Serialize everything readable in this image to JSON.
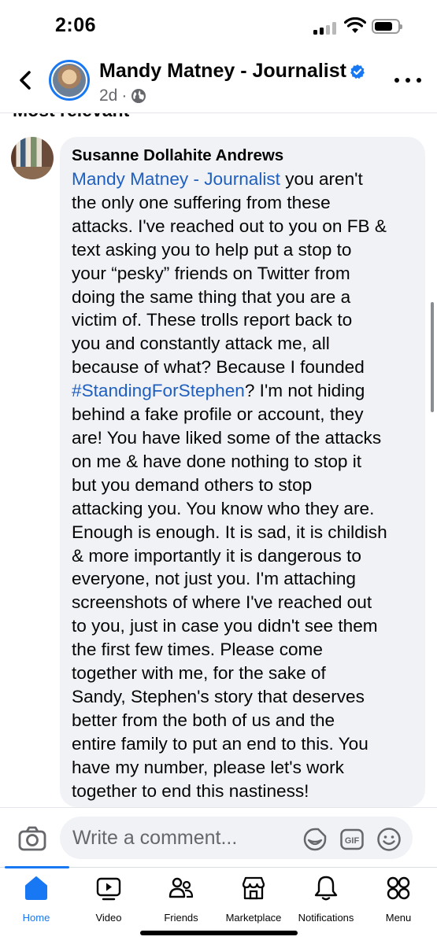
{
  "status_bar": {
    "time": "2:06"
  },
  "header": {
    "page_name": "Mandy Matney - Journalist",
    "verified": true,
    "post_age": "2d",
    "separator": "·",
    "privacy_icon": "globe-icon"
  },
  "comments_section": {
    "heading": "Most relevant",
    "comment": {
      "author": "Susanne Dollahite Andrews",
      "mention": "Mandy Matney - Journalist",
      "text_before_hashtag": " you aren't\nthe only one suffering from these\nattacks. I've reached out to you on FB &\ntext asking you to help put a stop to\nyour “pesky” friends on Twitter from\ndoing the same thing that you are a\nvictim of. These trolls report back to\nyou and constantly attack me, all\nbecause of what? Because I founded\n",
      "hashtag": "#StandingForStephen",
      "text_after_hashtag": "? I'm not hiding\nbehind a fake profile or account, they\nare! You have liked some of the attacks\non me & have done nothing to stop it\nbut you demand others to stop\nattacking you. You know who they are.\nEnough is enough. It is sad, it is childish\n& more importantly it is dangerous to\neveryone, not just you. I'm attaching\nscreenshots of where I've reached out\nto you, just in case you didn't see them\nthe first few times. Please come\ntogether with me, for the sake of\nSandy, Stephen's story that deserves\nbetter from the both of us and the\nentire family to put an end to this. You\nhave my number, please let's work\ntogether to end this nastiness!"
    }
  },
  "composer": {
    "placeholder": "Write a comment...",
    "gif_label": "GIF"
  },
  "bottom_nav": {
    "active_color": "#1877f2",
    "tabs": [
      {
        "label": "Home",
        "icon": "home-icon"
      },
      {
        "label": "Video",
        "icon": "video-icon"
      },
      {
        "label": "Friends",
        "icon": "friends-icon"
      },
      {
        "label": "Marketplace",
        "icon": "marketplace-icon"
      },
      {
        "label": "Notifications",
        "icon": "bell-icon"
      },
      {
        "label": "Menu",
        "icon": "menu-grid-icon"
      }
    ]
  }
}
